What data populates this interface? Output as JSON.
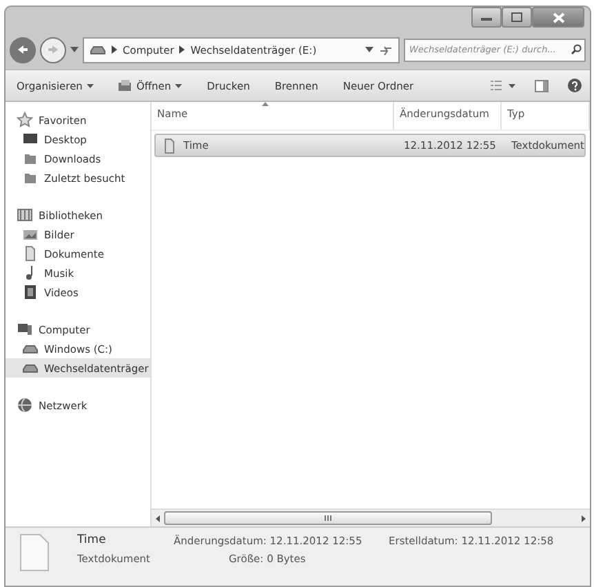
{
  "address_bar": {
    "crumbs": [
      "Computer",
      "Wechseldatenträger (E:)"
    ]
  },
  "search": {
    "placeholder": "Wechseldatenträger (E:) durch..."
  },
  "toolbar": {
    "items": [
      {
        "label": "Organisieren",
        "dropdown": true
      },
      {
        "label": "Öffnen",
        "dropdown": true
      },
      {
        "label": "Drucken",
        "dropdown": false
      },
      {
        "label": "Brennen",
        "dropdown": false
      },
      {
        "label": "Neuer Ordner",
        "dropdown": false
      }
    ]
  },
  "sidebar": {
    "groups": [
      {
        "label": "Favoriten",
        "selected": false,
        "children": [
          {
            "label": "Desktop",
            "selected": false
          },
          {
            "label": "Downloads",
            "selected": false
          },
          {
            "label": "Zuletzt besucht",
            "selected": false
          }
        ]
      },
      {
        "label": "Bibliotheken",
        "selected": false,
        "children": [
          {
            "label": "Bilder",
            "selected": false
          },
          {
            "label": "Dokumente",
            "selected": false
          },
          {
            "label": "Musik",
            "selected": false
          },
          {
            "label": "Videos",
            "selected": false
          }
        ]
      },
      {
        "label": "Computer",
        "selected": false,
        "children": [
          {
            "label": "Windows (C:)",
            "selected": false
          },
          {
            "label": "Wechseldatenträger",
            "selected": true
          }
        ]
      },
      {
        "label": "Netzwerk",
        "selected": false
      }
    ]
  },
  "table": {
    "columns": [
      "Name",
      "Änderungsdatum",
      "Typ"
    ],
    "rows": [
      {
        "name": "Time",
        "modified": "12.11.2012 12:55",
        "type": "Textdokument",
        "selected": true
      }
    ]
  },
  "details": {
    "name": "Time",
    "type": "Textdokument",
    "modified": "Änderungsdatum: 12.11.2012 12:55",
    "created": "Erstelldatum: 12.11.2012 12:58",
    "size": "Größe: 0 Bytes"
  }
}
